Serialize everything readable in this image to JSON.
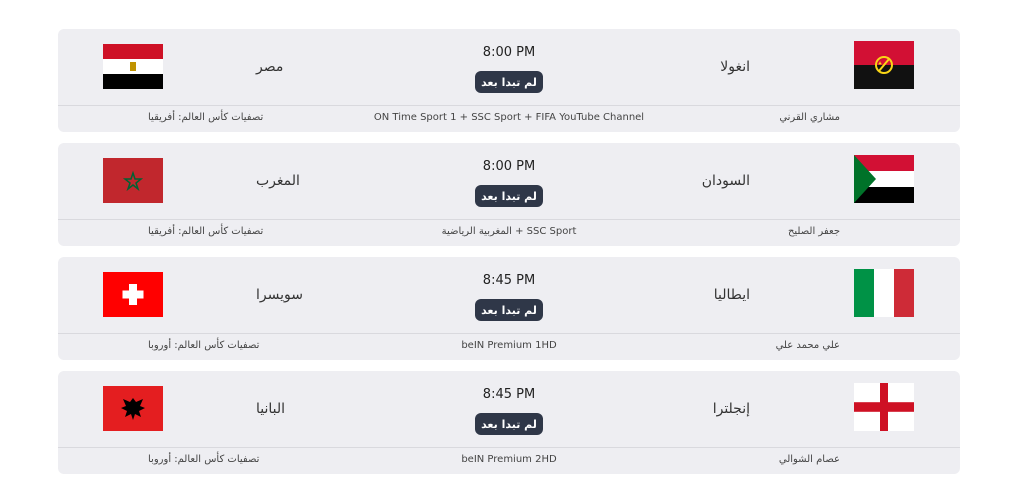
{
  "matches": [
    {
      "home_team": "انغولا",
      "away_team": "مصر",
      "time": "8:00 PM",
      "status": "لم تبدا بعد",
      "commentator": "مشاري القرني",
      "channels": "ON Time Sport 1 + SSC Sport + FIFA YouTube Channel",
      "competition": "تصفيات كأس العالم: أفريقيا",
      "home_flag": "angola-flag-icon",
      "away_flag": "egypt-flag-icon"
    },
    {
      "home_team": "السودان",
      "away_team": "المغرب",
      "time": "8:00 PM",
      "status": "لم تبدا بعد",
      "commentator": "جعفر الصليح",
      "channels": "المغربية الرياضية + SSC Sport",
      "competition": "تصفيات كأس العالم: أفريقيا",
      "home_flag": "sudan-flag-icon",
      "away_flag": "morocco-flag-icon"
    },
    {
      "home_team": "ايطاليا",
      "away_team": "سويسرا",
      "time": "8:45 PM",
      "status": "لم تبدا بعد",
      "commentator": "علي محمد علي",
      "channels": "beIN Premium 1HD",
      "competition": "تصفيات كأس العالم: أوروبا",
      "home_flag": "italy-flag-icon",
      "away_flag": "switzerland-flag-icon"
    },
    {
      "home_team": "إنجلترا",
      "away_team": "البانيا",
      "time": "8:45 PM",
      "status": "لم تبدا بعد",
      "commentator": "عصام الشوالي",
      "channels": "beIN Premium 2HD",
      "competition": "تصفيات كأس العالم: أوروبا",
      "home_flag": "england-flag-icon",
      "away_flag": "albania-flag-icon"
    }
  ],
  "colors": {
    "card_bg": "#eeeef2",
    "status_bg": "#2f3748",
    "divider": "#d9d9de"
  }
}
